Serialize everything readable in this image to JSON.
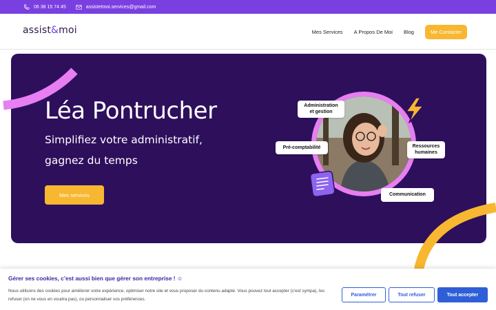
{
  "topbar": {
    "phone": "06 38 15 74 45",
    "email": "assistetmoi.services@gmail.com"
  },
  "header": {
    "logo_text_1": "assist",
    "logo_amp": "&",
    "logo_text_2": "moi",
    "nav": {
      "services": "Mes Services",
      "about": "A Propos De Moi",
      "blog": "Blog",
      "contact": "Me Contacter"
    }
  },
  "hero": {
    "title": "Léa Pontrucher",
    "subtitle_line1": "Simplifiez votre administratif,",
    "subtitle_line2": "gagnez du temps",
    "button": "Mes services",
    "tags": {
      "admin_line1": "Administration",
      "admin_line2": "et gestion",
      "compta": "Pré-comptabilité",
      "rh_line1": "Ressources",
      "rh_line2": "humaines",
      "com": "Communication"
    }
  },
  "cookie": {
    "title": "Gérer ses cookies, c’est aussi bien que gérer son entreprise ! ☺",
    "text": "Nous utilisons des cookies pour améliorer votre expérience, optimiser notre site et vous proposer du contenu adapté. Vous pouvez tout accepter (c'est sympa), les refuser (on ne vous en voudra pas), ou personnaliser vos préférences.",
    "settings": "Paramétrer",
    "refuse": "Tout refuser",
    "accept": "Tout accepter"
  },
  "colors": {
    "topbar": "#7a3fe0",
    "hero_bg": "#2e0f5c",
    "accent_yellow": "#f7b731",
    "accent_pink": "#e77ef2",
    "cookie_blue": "#2f5fd6"
  }
}
